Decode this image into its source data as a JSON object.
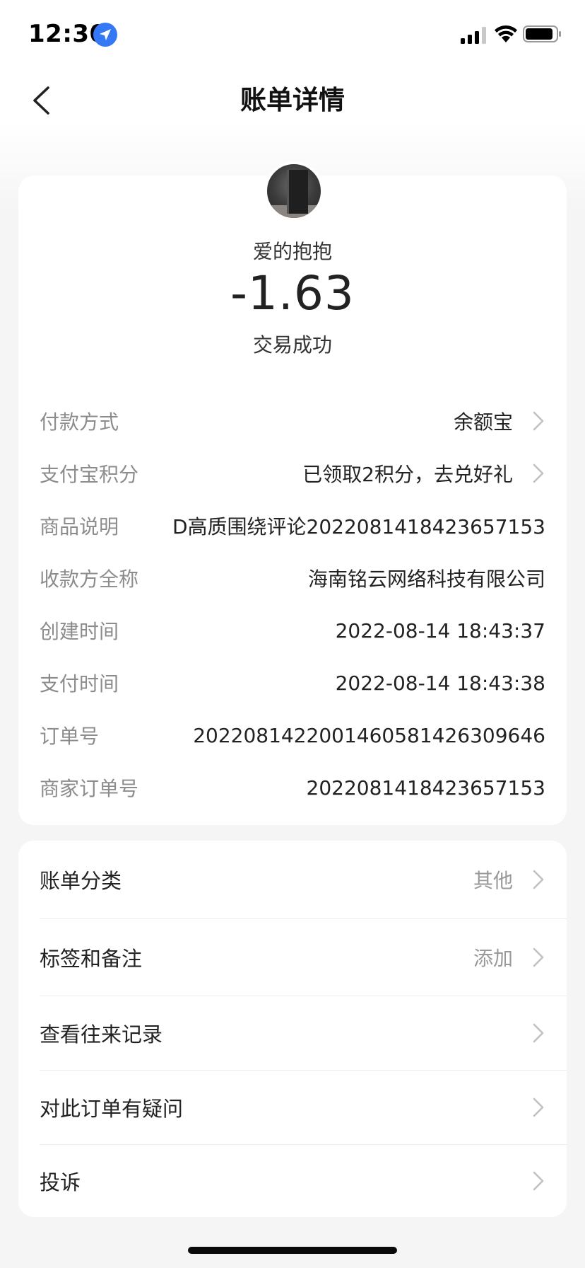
{
  "status_bar": {
    "time": "12:30"
  },
  "nav": {
    "title": "账单详情"
  },
  "summary": {
    "merchant_name": "爱的抱抱",
    "amount": "-1.63",
    "status": "交易成功"
  },
  "details": [
    {
      "label": "付款方式",
      "value": "余额宝",
      "has_chevron": true
    },
    {
      "label": "支付宝积分",
      "value": "已领取2积分，去兑好礼",
      "has_chevron": true
    },
    {
      "label": "商品说明",
      "value": "D高质围绕评论2022081418423657153",
      "has_chevron": false
    },
    {
      "label": "收款方全称",
      "value": "海南铭云网络科技有限公司",
      "has_chevron": false
    },
    {
      "label": "创建时间",
      "value": "2022-08-14 18:43:37",
      "has_chevron": false
    },
    {
      "label": "支付时间",
      "value": "2022-08-14 18:43:38",
      "has_chevron": false
    },
    {
      "label": "订单号",
      "value": "20220814220014605814263096​46",
      "has_chevron": false
    },
    {
      "label": "商家订单号",
      "value": "2022081418423657153",
      "has_chevron": false
    }
  ],
  "actions": [
    {
      "label": "账单分类",
      "value": "其他"
    },
    {
      "label": "标签和备注",
      "value": "添加"
    },
    {
      "label": "查看往来记录",
      "value": ""
    },
    {
      "label": "对此订单有疑问",
      "value": ""
    },
    {
      "label": "投诉",
      "value": ""
    }
  ],
  "icons": {
    "location": "location-arrow-icon",
    "signal": "cellular-signal-icon",
    "wifi": "wifi-icon",
    "battery": "battery-icon",
    "back": "chevron-left-icon",
    "chevron": "chevron-right-icon"
  },
  "colors": {
    "location_badge": "#3478f6",
    "label_gray": "#8c8c8c",
    "value_dark": "#222222",
    "chevron_gray": "#c2c2c2"
  }
}
